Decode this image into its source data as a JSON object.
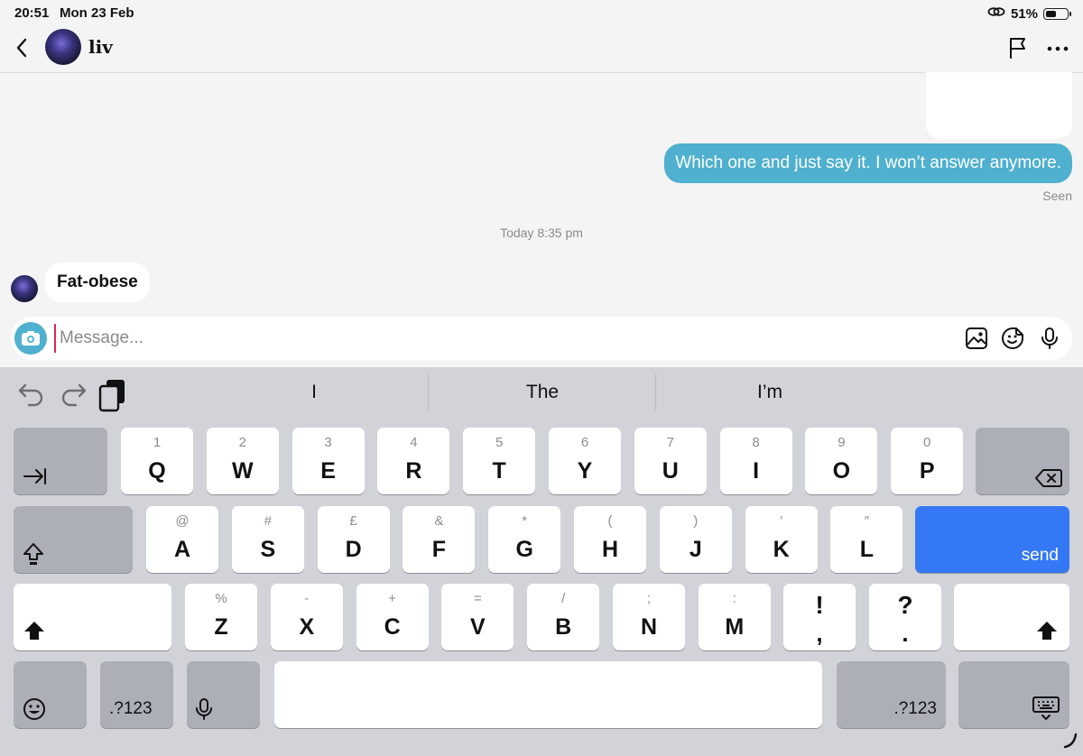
{
  "status_bar": {
    "time": "20:51",
    "date": "Mon 23 Feb",
    "battery": "51%"
  },
  "header": {
    "contact_name": "liv"
  },
  "messages": {
    "outgoing_text": "Which one and just say it. I won’t answer anymore.",
    "seen_label": "Seen",
    "timestamp": "Today 8:35 pm",
    "incoming_text": "Fat-obese"
  },
  "composer": {
    "placeholder": "Message..."
  },
  "keyboard": {
    "suggestions": [
      "I",
      "The",
      "I’m"
    ],
    "row1": [
      {
        "sec": "1",
        "key": "Q"
      },
      {
        "sec": "2",
        "key": "W"
      },
      {
        "sec": "3",
        "key": "E"
      },
      {
        "sec": "4",
        "key": "R"
      },
      {
        "sec": "5",
        "key": "T"
      },
      {
        "sec": "6",
        "key": "Y"
      },
      {
        "sec": "7",
        "key": "U"
      },
      {
        "sec": "8",
        "key": "I"
      },
      {
        "sec": "9",
        "key": "O"
      },
      {
        "sec": "0",
        "key": "P"
      }
    ],
    "row2": [
      {
        "sec": "@",
        "key": "A"
      },
      {
        "sec": "#",
        "key": "S"
      },
      {
        "sec": "£",
        "key": "D"
      },
      {
        "sec": "&",
        "key": "F"
      },
      {
        "sec": "*",
        "key": "G"
      },
      {
        "sec": "(",
        "key": "H"
      },
      {
        "sec": ")",
        "key": "J"
      },
      {
        "sec": "′",
        "key": "K"
      },
      {
        "sec": "″",
        "key": "L"
      }
    ],
    "row3": [
      {
        "sec": "%",
        "key": "Z"
      },
      {
        "sec": "-",
        "key": "X"
      },
      {
        "sec": "+",
        "key": "C"
      },
      {
        "sec": "=",
        "key": "V"
      },
      {
        "sec": "/",
        "key": "B"
      },
      {
        "sec": ";",
        "key": "N"
      },
      {
        "sec": ":",
        "key": "M"
      }
    ],
    "punct_keys": [
      {
        "top": "!",
        "bottom": ","
      },
      {
        "top": "?",
        "bottom": "."
      }
    ],
    "send_label": "send",
    "numbers_label": ".?123",
    "icons": [
      "tab-icon",
      "delete-icon",
      "caps-lock-icon",
      "shift-icon",
      "emoji-icon",
      "dictation-icon",
      "hide-keyboard-icon",
      "undo-icon",
      "redo-icon",
      "paste-icon"
    ]
  },
  "colors": {
    "accent": "#4fb0cf",
    "send_key": "#3478f6",
    "keyboard_bg": "#d1d3d9"
  }
}
